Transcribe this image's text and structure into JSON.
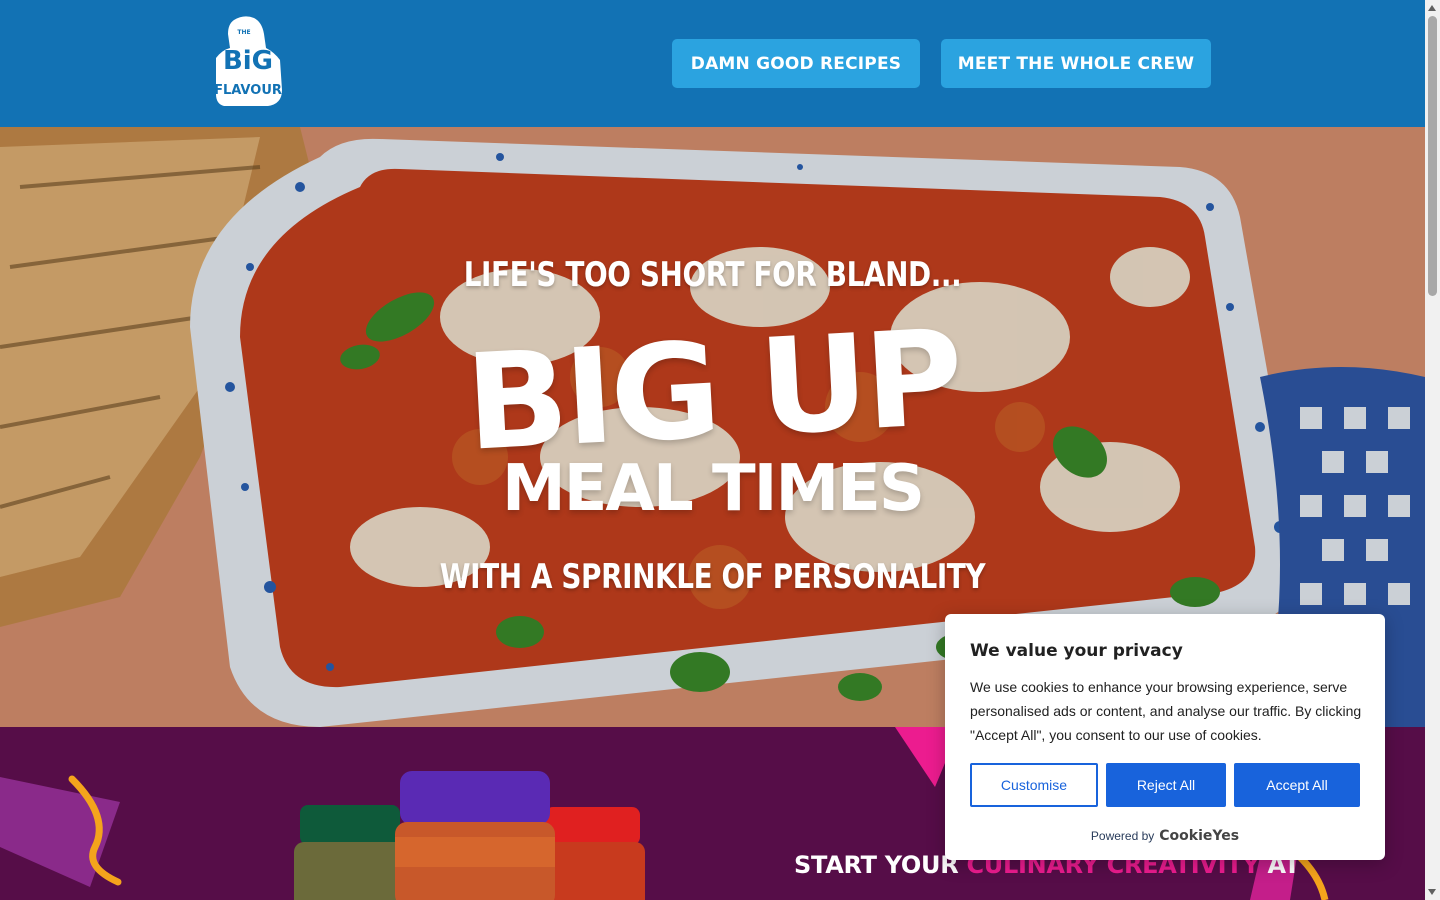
{
  "header": {
    "logo_text": "THE BIG FLAVOUR CO.",
    "nav": [
      {
        "label": "DAMN GOOD RECIPES"
      },
      {
        "label": "MEET THE WHOLE CREW"
      }
    ],
    "background": "#1272b4",
    "button_color": "#2ba3e0"
  },
  "hero": {
    "tagline_top": "LIFE'S TOO SHORT FOR BLAND...",
    "headline": "BIG UP",
    "subheadline": "MEAL TIMES",
    "tagline_bottom": "WITH A SPRINKLE OF PERSONALITY"
  },
  "section": {
    "heading_part1": "START YOUR ",
    "heading_highlight": "CULINARY CREATIVITY",
    "heading_part2": " AT",
    "background": "#560d48",
    "highlight_color": "#ec1c8f"
  },
  "cookie_banner": {
    "title": "We value your privacy",
    "body": "We use cookies to enhance your browsing experience, serve personalised ads or content, and analyse our traffic. By clicking \"Accept All\", you consent to our use of cookies.",
    "customise_label": "Customise",
    "reject_label": "Reject All",
    "accept_label": "Accept All",
    "powered_by": "Powered by",
    "brand": "CookieYes",
    "accent": "#1863dc"
  }
}
